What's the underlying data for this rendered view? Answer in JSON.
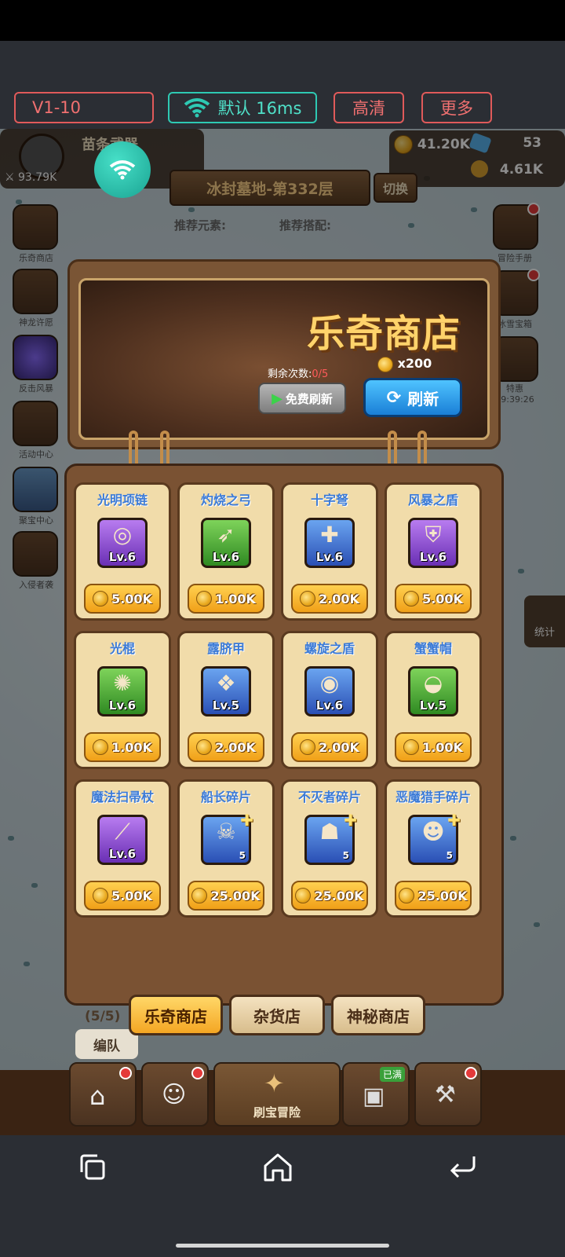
{
  "overlay": {
    "version_label": "V1-10",
    "network_label": "默认 16ms",
    "quality_label": "高清",
    "more_label": "更多"
  },
  "hud": {
    "player_name": "苗条武器",
    "power": "93.79K",
    "gold": "41.20K",
    "gems": "53",
    "stones": "4.61K",
    "stage_title": "冰封墓地-第332层",
    "switch_label": "切换",
    "recommend_element_label": "推荐元素:",
    "recommend_match_label": "推荐搭配:"
  },
  "side_menu": [
    {
      "label": "乐奇商店"
    },
    {
      "label": "神龙许愿"
    },
    {
      "label": "反击风暴"
    },
    {
      "label": "活动中心"
    },
    {
      "label": "聚宝中心"
    },
    {
      "label": "入侵者袭"
    }
  ],
  "right_menu": [
    {
      "label": "冒险手册"
    },
    {
      "label": "冰雪宝箱"
    },
    {
      "label": "特惠",
      "timer": "19:39:26"
    }
  ],
  "stats_label": "统计",
  "shop": {
    "title": "乐奇商店",
    "remaining_label": "剩余次数:",
    "remaining_value": "0/5",
    "free_refresh_label": "免费刷新",
    "refresh_cost": "x200",
    "refresh_label": "刷新",
    "items": [
      {
        "name": "光明项链",
        "level": "Lv.6",
        "price": "5.00K",
        "rarity": "purple",
        "icon": "necklace-icon"
      },
      {
        "name": "灼烧之弓",
        "level": "Lv.6",
        "price": "1.00K",
        "rarity": "green",
        "icon": "bow-icon"
      },
      {
        "name": "十字弩",
        "level": "Lv.6",
        "price": "2.00K",
        "rarity": "blue",
        "icon": "crossbow-icon"
      },
      {
        "name": "风暴之盾",
        "level": "Lv.6",
        "price": "5.00K",
        "rarity": "purple",
        "icon": "winged-shield-icon"
      },
      {
        "name": "光棍",
        "level": "Lv.6",
        "price": "1.00K",
        "rarity": "green",
        "icon": "mace-icon"
      },
      {
        "name": "露脐甲",
        "level": "Lv.5",
        "price": "2.00K",
        "rarity": "blue",
        "icon": "armor-icon"
      },
      {
        "name": "螺旋之盾",
        "level": "Lv.6",
        "price": "2.00K",
        "rarity": "blue",
        "icon": "spiral-shield-icon"
      },
      {
        "name": "蟹蟹帽",
        "level": "Lv.5",
        "price": "1.00K",
        "rarity": "green",
        "icon": "crab-hat-icon"
      },
      {
        "name": "魔法扫帚杖",
        "level": "Lv.6",
        "price": "5.00K",
        "rarity": "purple",
        "icon": "broom-staff-icon"
      },
      {
        "name": "船长碎片",
        "level": "",
        "count": "5",
        "price": "25.00K",
        "rarity": "blue",
        "icon": "captain-shard-icon"
      },
      {
        "name": "不灭者碎片",
        "level": "",
        "count": "5",
        "price": "25.00K",
        "rarity": "blue",
        "icon": "undying-shard-icon"
      },
      {
        "name": "恶魔猎手碎片",
        "level": "",
        "count": "5",
        "price": "25.00K",
        "rarity": "blue",
        "icon": "demon-hunter-shard-icon"
      }
    ],
    "tabs": [
      {
        "label": "乐奇商店",
        "active": true
      },
      {
        "label": "杂货店",
        "active": false
      },
      {
        "label": "神秘商店",
        "active": false
      }
    ]
  },
  "team": {
    "count": "(5/5)",
    "edit_label": "编队"
  },
  "game_nav": [
    {
      "label": "商店",
      "icon": "shop-icon"
    },
    {
      "label": "英雄",
      "icon": "hero-icon"
    },
    {
      "label": "刷宝冒险",
      "icon": "adventure-icon"
    },
    {
      "label": "已满",
      "icon": "chest-icon"
    },
    {
      "label": "锻造",
      "icon": "forge-icon"
    }
  ],
  "colors": {
    "accent_gold": "#f4a623",
    "refresh_blue": "#1a7fd6",
    "title_gold": "#ffd36b",
    "name_blue": "#3b7ad6"
  }
}
